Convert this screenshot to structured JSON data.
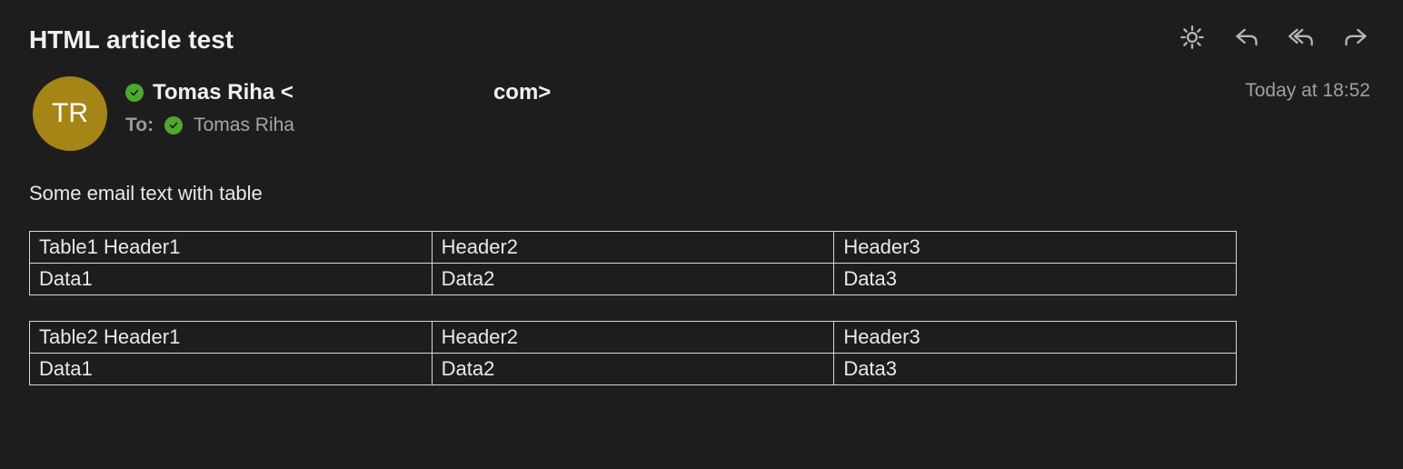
{
  "colors": {
    "avatar_bg": "#a48516"
  },
  "header": {
    "subject": "HTML article test"
  },
  "meta": {
    "avatar_initials": "TR",
    "from_name": "Tomas Riha <",
    "from_suffix": "com>",
    "to_label": "To:",
    "to_name": "Tomas Riha",
    "timestamp": "Today at 18:52"
  },
  "body_text": "Some email text with table",
  "tables": [
    {
      "headers": [
        "Table1 Header1",
        "Header2",
        "Header3"
      ],
      "rows": [
        [
          "Data1",
          "Data2",
          "Data3"
        ]
      ]
    },
    {
      "headers": [
        "Table2 Header1",
        "Header2",
        "Header3"
      ],
      "rows": [
        [
          "Data1",
          "Data2",
          "Data3"
        ]
      ]
    }
  ]
}
